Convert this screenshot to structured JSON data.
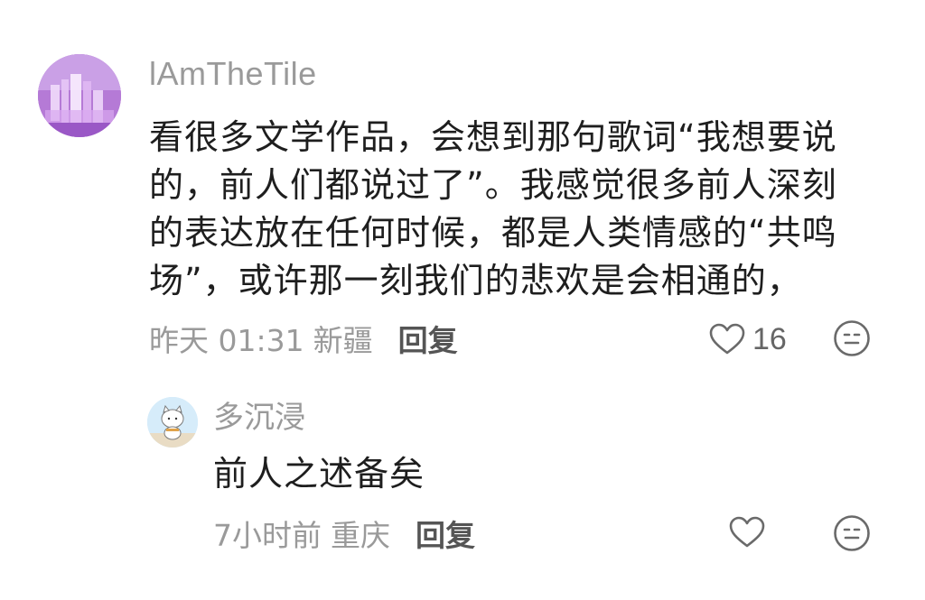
{
  "main_comment": {
    "username": "lAmTheTile",
    "body_lines": [
      "看很多文学作品，会想到那句歌词“我想要说",
      "的，前人们都说过了”。我感觉很多前人深刻",
      "的表达放在任何时候，都是人类情感的“共鸣",
      "场”，或许那一刻我们的悲欢是会相通的，"
    ],
    "time": "昨天 01:31",
    "location": "新疆",
    "reply_label": "回复",
    "like_count": "16",
    "avatar_icon": "purple-abstract-avatar",
    "like_icon": "heart-outline-icon",
    "emoji_icon": "smile-face-icon"
  },
  "reply_comment": {
    "username": "多沉浸",
    "body": "前人之述备矣",
    "time": "7小时前",
    "location": "重庆",
    "reply_label": "回复",
    "avatar_icon": "cartoon-cat-avatar",
    "like_icon": "heart-outline-icon",
    "emoji_icon": "smile-face-icon"
  },
  "colors": {
    "text_primary": "#1e1e1e",
    "text_secondary": "#9a9a9a",
    "reply_label": "#555555",
    "icon_stroke": "#6a6a6a",
    "background": "#ffffff"
  }
}
